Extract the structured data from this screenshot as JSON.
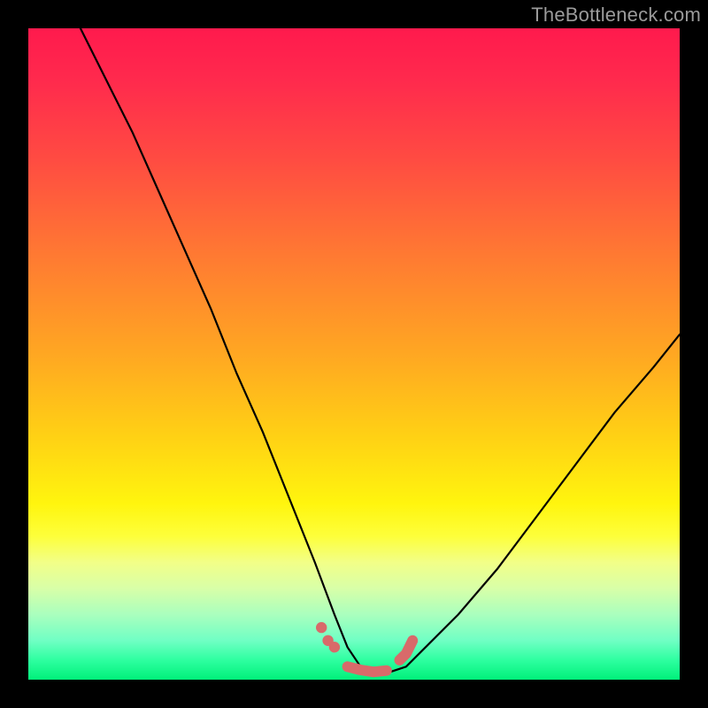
{
  "watermark": "TheBottleneck.com",
  "colors": {
    "frame": "#000000",
    "curve": "#000000",
    "marker": "#d86a6a",
    "watermark_text": "#9b9b9b",
    "gradient_stops": [
      "#ff1a4d",
      "#ff2a4d",
      "#ff4b42",
      "#ff7a32",
      "#ffa722",
      "#ffd214",
      "#fff50e",
      "#fdff3b",
      "#f2ff88",
      "#d8ffa8",
      "#aaffbe",
      "#70ffc4",
      "#2effa0",
      "#00f07a"
    ]
  },
  "chart_data": {
    "type": "line",
    "title": "",
    "xlabel": "",
    "ylabel": "",
    "xlim": [
      0,
      100
    ],
    "ylim": [
      0,
      100
    ],
    "grid": false,
    "series": [
      {
        "name": "bottleneck-curve",
        "x": [
          8,
          12,
          16,
          20,
          24,
          28,
          32,
          36,
          40,
          44,
          47,
          49,
          51,
          53,
          55,
          58,
          61,
          66,
          72,
          78,
          84,
          90,
          96,
          100
        ],
        "y": [
          100,
          92,
          84,
          75,
          66,
          57,
          47,
          38,
          28,
          18,
          10,
          5,
          2,
          1,
          1,
          2,
          5,
          10,
          17,
          25,
          33,
          41,
          48,
          53
        ]
      }
    ],
    "annotation": {
      "name": "optimal-region-marker",
      "description": "highlighted points near the curve minimum (best match region)",
      "points_xy": [
        [
          45,
          8
        ],
        [
          46,
          6
        ],
        [
          47,
          5
        ],
        [
          49,
          2
        ],
        [
          51,
          1.5
        ],
        [
          53,
          1.2
        ],
        [
          55,
          1.4
        ],
        [
          57,
          3
        ],
        [
          58,
          4
        ],
        [
          59,
          6
        ]
      ]
    }
  }
}
